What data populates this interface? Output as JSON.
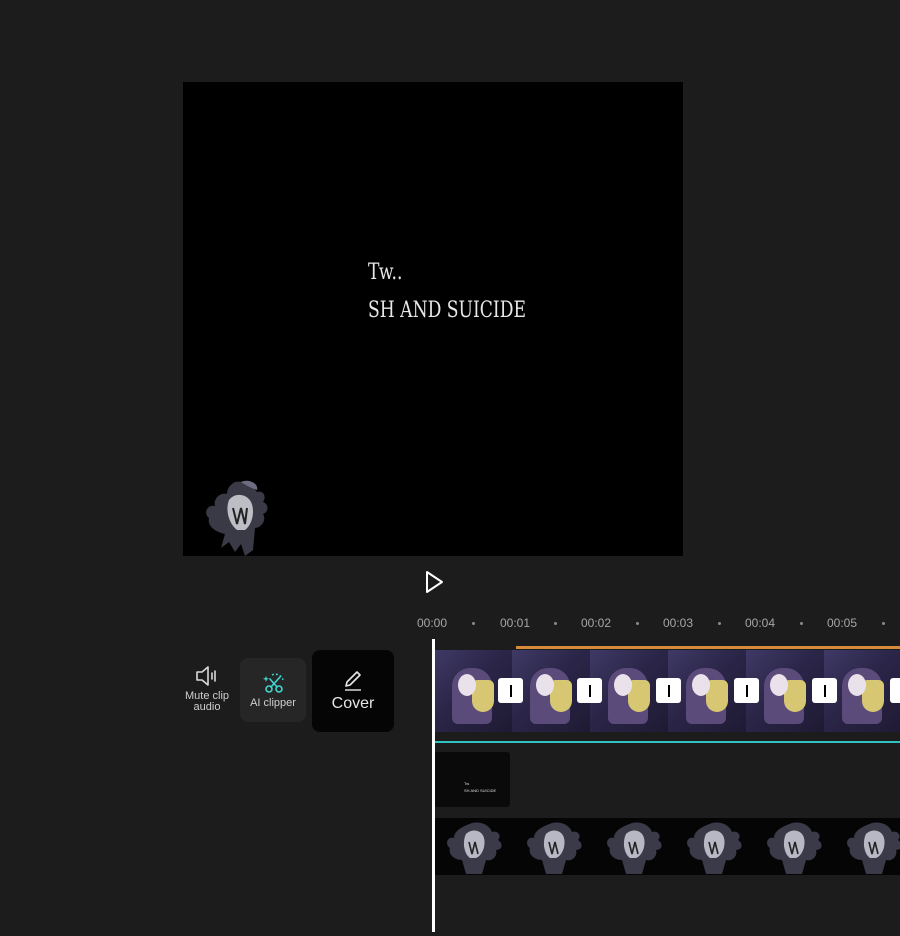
{
  "preview": {
    "overlay_text_line1": "Tw..",
    "overlay_text_line2": "SH AND SUICIDE",
    "play_icon": "play-icon"
  },
  "timeline": {
    "ticks": [
      "00:00",
      "00:01",
      "00:02",
      "00:03",
      "00:04",
      "00:05"
    ]
  },
  "tools": {
    "mute_label": "Mute clip audio",
    "ai_label": "AI clipper",
    "cover_label": "Cover"
  },
  "text_clip": {
    "line1": "Tw",
    "line2": "SH AND SUICIDE"
  },
  "colors": {
    "accent_teal": "#2ec2c2",
    "accent_orange": "#d68a3a",
    "background": "#1c1c1c"
  }
}
